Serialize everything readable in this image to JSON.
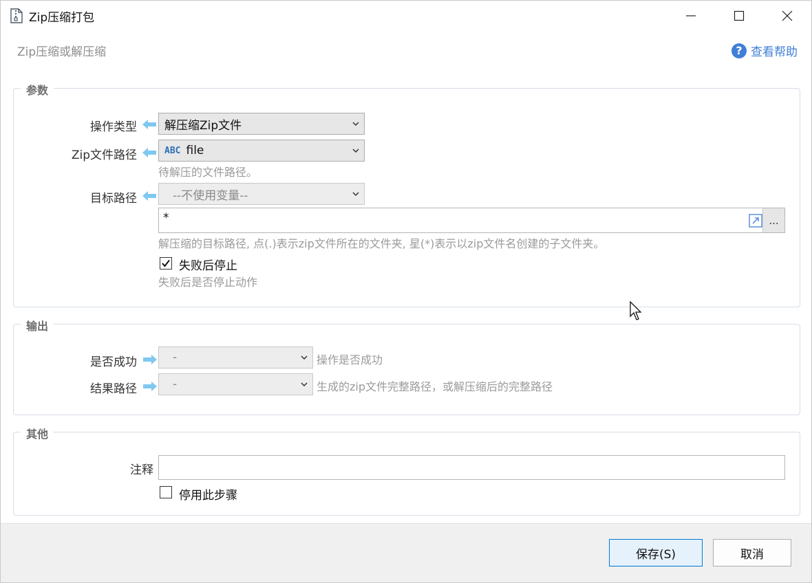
{
  "window": {
    "title": "Zip压缩打包",
    "subtitle": "Zip压缩或解压缩",
    "help_label": "查看帮助"
  },
  "groups": {
    "params": "参数",
    "output": "输出",
    "other": "其他"
  },
  "params": {
    "op_type": {
      "label": "操作类型",
      "value": "解压缩Zip文件"
    },
    "zip_path": {
      "label": "Zip文件路径",
      "type_tag": "ABC",
      "value": "file",
      "hint": "待解压的文件路径。"
    },
    "target_path": {
      "label": "目标路径",
      "value": "--不使用变量--",
      "input_value": "*",
      "dots": "...",
      "hint": "解压缩的目标路径, 点(.)表示zip文件所在的文件夹, 星(*)表示以zip文件名创建的子文件夹。"
    },
    "stop_on_fail": {
      "label": "失败后停止",
      "checked": true,
      "hint": "失败后是否停止动作"
    }
  },
  "output": {
    "success": {
      "label": "是否成功",
      "value": "-",
      "hint": "操作是否成功"
    },
    "result_path": {
      "label": "结果路径",
      "value": "-",
      "hint": "生成的zip文件完整路径，或解压缩后的完整路径"
    }
  },
  "other": {
    "comment": {
      "label": "注释",
      "value": ""
    },
    "disable_step": {
      "label": "停用此步骤",
      "checked": false
    }
  },
  "footer": {
    "save_label": "保存(S)",
    "cancel_label": "取消"
  },
  "colors": {
    "accent": "#3f7fd6",
    "arrow": "#7fc8f0",
    "save_border": "#0078d7"
  }
}
